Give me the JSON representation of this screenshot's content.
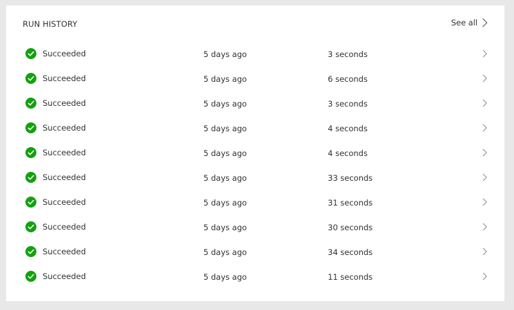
{
  "panel": {
    "title": "RUN HISTORY",
    "see_all_label": "See all"
  },
  "colors": {
    "success": "#13a10e",
    "chevron": "#8a8886"
  },
  "icons": {
    "status": "success-check-circle-icon",
    "row_action": "chevron-right-icon"
  },
  "runs": [
    {
      "status": "Succeeded",
      "started": "5 days ago",
      "duration": "3 seconds"
    },
    {
      "status": "Succeeded",
      "started": "5 days ago",
      "duration": "6 seconds"
    },
    {
      "status": "Succeeded",
      "started": "5 days ago",
      "duration": "3 seconds"
    },
    {
      "status": "Succeeded",
      "started": "5 days ago",
      "duration": "4 seconds"
    },
    {
      "status": "Succeeded",
      "started": "5 days ago",
      "duration": "4 seconds"
    },
    {
      "status": "Succeeded",
      "started": "5 days ago",
      "duration": "33 seconds"
    },
    {
      "status": "Succeeded",
      "started": "5 days ago",
      "duration": "31 seconds"
    },
    {
      "status": "Succeeded",
      "started": "5 days ago",
      "duration": "30 seconds"
    },
    {
      "status": "Succeeded",
      "started": "5 days ago",
      "duration": "34 seconds"
    },
    {
      "status": "Succeeded",
      "started": "5 days ago",
      "duration": "11 seconds"
    }
  ]
}
